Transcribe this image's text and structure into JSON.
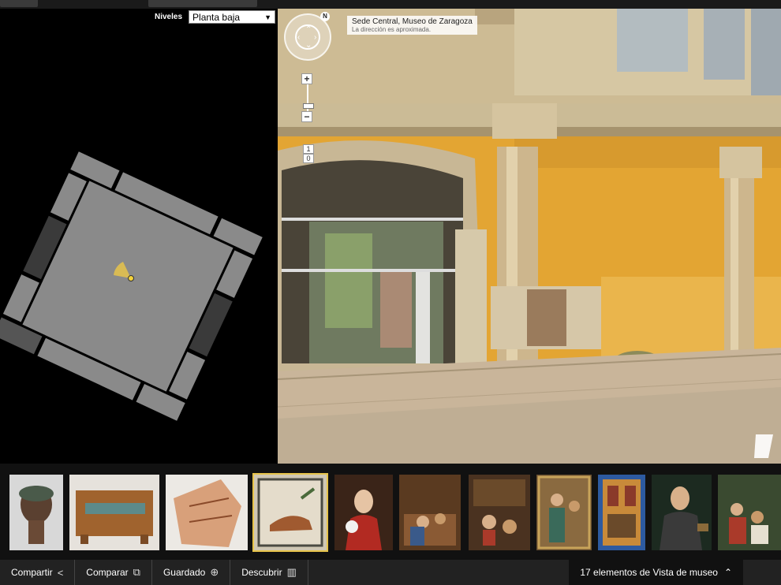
{
  "levels": {
    "label": "Niveles",
    "selected": "Planta baja"
  },
  "location": {
    "title": "Sede Central, Museo de Zaragoza",
    "subtitle": "La dirección es aproximada."
  },
  "compass": {
    "north_label": "N"
  },
  "zoom": {
    "in_label": "+",
    "out_label": "−"
  },
  "floors": [
    "1",
    "0"
  ],
  "thumbnails": [
    {
      "name": "bronze-head-thumb",
      "bg": "#d8d8d8",
      "selected": false
    },
    {
      "name": "enamel-chest-thumb",
      "bg": "#e6e2dc",
      "selected": false
    },
    {
      "name": "ceramic-fragment-thumb",
      "bg": "#ece9e4",
      "selected": false
    },
    {
      "name": "mosaic-horse-thumb",
      "bg": "#cfc7b4",
      "selected": true
    },
    {
      "name": "lady-portrait-thumb",
      "bg": "#3a2418",
      "selected": false
    },
    {
      "name": "nativity-painting-thumb",
      "bg": "#5a3a20",
      "selected": false
    },
    {
      "name": "adoration-painting-thumb",
      "bg": "#4a3220",
      "selected": false
    },
    {
      "name": "saints-painting-thumb",
      "bg": "#6a5030",
      "selected": false
    },
    {
      "name": "altarpiece-thumb",
      "bg": "#2d5aa0",
      "selected": false
    },
    {
      "name": "armored-man-portrait-thumb",
      "bg": "#1c2a20",
      "selected": false
    },
    {
      "name": "group-painting-thumb",
      "bg": "#3a4a30",
      "selected": false
    }
  ],
  "bottombar": {
    "share": "Compartir",
    "compare": "Comparar",
    "saved": "Guardado",
    "discover": "Descubrir",
    "count": "17 elementos de Vista de museo"
  },
  "icons": {
    "share": "share-icon",
    "compare": "compare-icon",
    "saved": "add-saved-icon",
    "discover": "books-icon",
    "chevron": "chevron-up-icon"
  },
  "colors": {
    "wall": "#e5a73a",
    "column": "#d9c7a0",
    "floorplan": "#888888",
    "marker": "#e6c34a",
    "selected": "#e6c34a"
  }
}
